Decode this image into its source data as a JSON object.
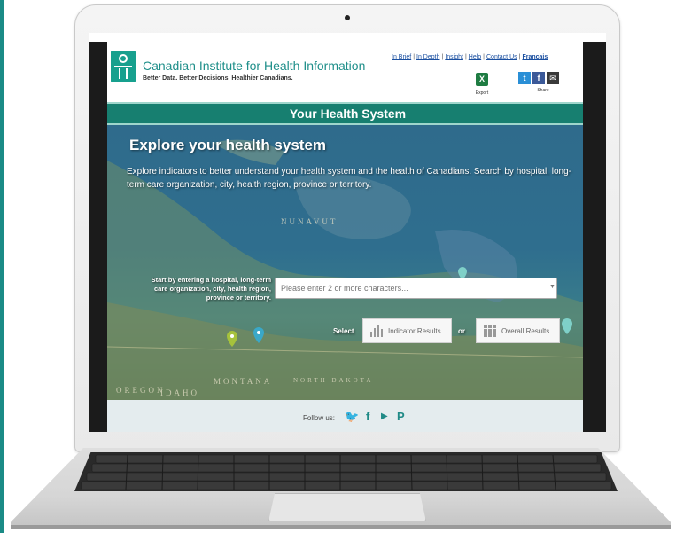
{
  "colors": {
    "brand_teal": "#1f8f8a",
    "title_band": "#177f70",
    "link_blue": "#1a4fa0",
    "follow_bar": "#e4ecee"
  },
  "header": {
    "org_name": "Canadian Institute for Health Information",
    "tagline": "Better Data. Better Decisions. Healthier Canadians.",
    "logo_icon": "cihi-logo-icon",
    "links": [
      "In Brief",
      "In Depth",
      "Insight",
      "Help",
      "Contact Us",
      "Français"
    ],
    "link_separator": "|",
    "export": {
      "icon": "excel-icon",
      "icon_text": "X",
      "label": "Export"
    },
    "share": {
      "label": "Share",
      "icons": [
        {
          "name": "twitter-icon",
          "glyph": "t"
        },
        {
          "name": "facebook-icon",
          "glyph": "f"
        },
        {
          "name": "email-icon",
          "glyph": "✉"
        }
      ]
    }
  },
  "title_band": {
    "text": "Your Health System"
  },
  "hero": {
    "title": "Explore your health system",
    "description": "Explore indicators to better understand your health system and the health of Canadians. Search by hospital, long-term care organization, city, health region, province or territory.",
    "start_label": "Start by entering a hospital, long-term care organization, city, health region, province or territory.",
    "search": {
      "placeholder": "Please enter 2 or more characters...",
      "value": ""
    },
    "select_label": "Select",
    "or_label": "or",
    "indicator_button": {
      "label": "Indicator Results",
      "icon": "bar-chart-icon"
    },
    "overall_button": {
      "label": "Overall Results",
      "icon": "grid-icon"
    },
    "map_labels": [
      "NUNAVUT",
      "MONTANA",
      "NORTH DAKOTA",
      "IDAHO",
      "OREGON"
    ]
  },
  "footer": {
    "follow_label": "Follow us:",
    "icons": [
      {
        "name": "twitter-icon",
        "glyph": "🐦"
      },
      {
        "name": "facebook-icon",
        "glyph": "f"
      },
      {
        "name": "youtube-icon",
        "glyph": "▶"
      },
      {
        "name": "pinterest-icon",
        "glyph": "P"
      }
    ]
  }
}
